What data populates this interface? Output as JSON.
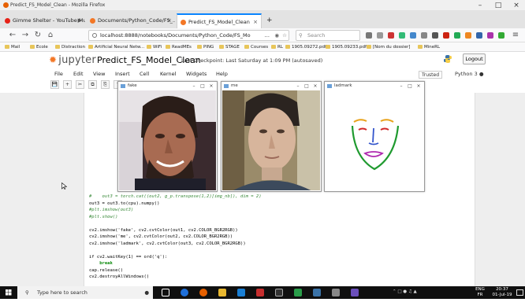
{
  "window": {
    "title": "Predict_FS_Model_Clean - Mozilla Firefox"
  },
  "tabs": [
    {
      "label": "Gimme Shelter - YouTube Music"
    },
    {
      "label": "Documents/Python_Code/FS_..."
    },
    {
      "label": "Predict_FS_Model_Clean"
    }
  ],
  "new_tab_symbol": "+",
  "nav": {
    "url": "localhost:8888/notebooks/Documents/Python_Code/FS_Mo",
    "url_ellipsis": "…",
    "search_placeholder": "Search",
    "back": "←",
    "forward": "→",
    "reload": "↻",
    "home": "⌂",
    "menu": "≡"
  },
  "bookmarks": [
    "Mail",
    "Ecole",
    "Distraction",
    "Artificial Neural Netw...",
    "WiFi",
    "ReadMEs",
    "PING",
    "STAGE",
    "Courses",
    "RL",
    "1905.09272.pdf",
    "1905.09233.pdf",
    "[Nom du dossier]",
    "MineRL"
  ],
  "jupyter": {
    "logo_text": "jupyter",
    "notebook_name": "Predict_FS_Model_Clean",
    "checkpoint": "Last Checkpoint: Last Saturday at 1:09 PM",
    "autosave": "(autosaved)",
    "logout": "Logout",
    "trusted": "Trusted",
    "kernel": "Python 3"
  },
  "menu": [
    "File",
    "Edit",
    "View",
    "Insert",
    "Cell",
    "Kernel",
    "Widgets",
    "Help"
  ],
  "toolbar": [
    "💾",
    "+",
    "✂",
    "⧉",
    "⎘",
    "↑"
  ],
  "cv_windows": [
    {
      "title": "fake"
    },
    {
      "title": "me"
    },
    {
      "title": "ladmark"
    }
  ],
  "code_lines": [
    {
      "text": "#    out3 = torch.cat((out2, g_p.transpose(1,2)[img_nb]), dim = 2)",
      "kind": "comment"
    },
    {
      "text": "out3 = out3.to(cpu).numpy()",
      "kind": "code"
    },
    {
      "text": "#plt.imshow(out3)",
      "kind": "comment"
    },
    {
      "text": "#plt.show()",
      "kind": "comment"
    },
    {
      "text": "",
      "kind": "code"
    },
    {
      "text": "cv2.imshow('fake', cv2.cvtColor(out1, cv2.COLOR_BGR2RGB))",
      "kind": "code"
    },
    {
      "text": "cv2.imshow('me', cv2.cvtColor(out2, cv2.COLOR_BGR2RGB))",
      "kind": "code"
    },
    {
      "text": "cv2.imshow('ladmark', cv2.cvtColor(out3, cv2.COLOR_BGR2RGB))",
      "kind": "code"
    },
    {
      "text": "",
      "kind": "code"
    },
    {
      "text": "if cv2.waitKey(1) == ord('q'):",
      "kind": "code"
    },
    {
      "text": "    break",
      "kind": "keyword"
    },
    {
      "text": "cap.release()",
      "kind": "code"
    },
    {
      "text": "cv2.destroyAllWindows()",
      "kind": "code"
    }
  ],
  "taskbar": {
    "search_placeholder": "Type here to search",
    "lang_top": "ENG",
    "lang_bottom": "FR",
    "time": "20:37",
    "date": "01-Jul-19"
  },
  "colors": {
    "accent": "#0a84ff",
    "jupyter_orange": "#f37726"
  }
}
